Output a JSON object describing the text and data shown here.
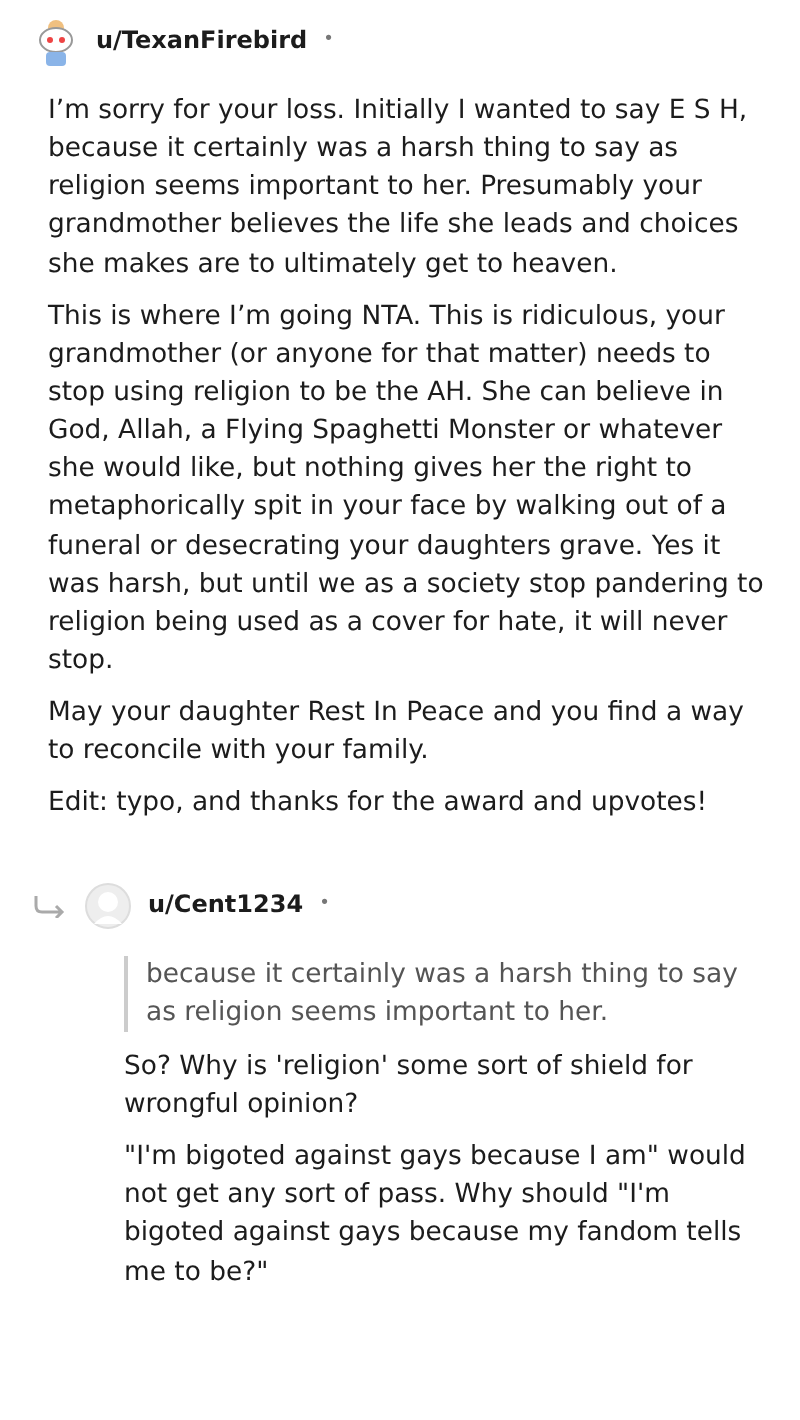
{
  "comments": [
    {
      "author": "u/TexanFirebird",
      "separator": "•",
      "reply": false,
      "paragraphs": [
        "I’m sorry for your loss. Initially I wanted to say E S H, because it certainly was a harsh thing to say as religion seems important to her. Presumably your grandmother believes the life she leads and choices she makes are to ultimately get to heaven.",
        "This is where I’m going NTA. This is ridiculous, your grandmother (or anyone for that matter) needs to stop using religion to be the AH. She can believe in God, Allah, a Flying Spaghetti Monster or whatever she would like, but nothing gives her the right to metaphorically spit in your face by walking out of a funeral or desecrating your daughters grave. Yes it was harsh, but until we as a society stop pandering to religion being used as a cover for hate, it will never stop.",
        "May your daughter Rest In Peace and you find a way to reconcile with your family.",
        "Edit: typo, and thanks for the award and upvotes!"
      ]
    },
    {
      "author": "u/Cent1234",
      "separator": "•",
      "reply": true,
      "quote": "because it certainly was a harsh thing to say as religion seems important to her.",
      "paragraphs": [
        "So? Why is 'religion' some sort of shield for wrongful opinion?",
        "\"I'm bigoted against gays because I am\" would not get any sort of pass. Why should \"I'm bigoted against gays because my fandom tells me to be?\""
      ]
    }
  ]
}
